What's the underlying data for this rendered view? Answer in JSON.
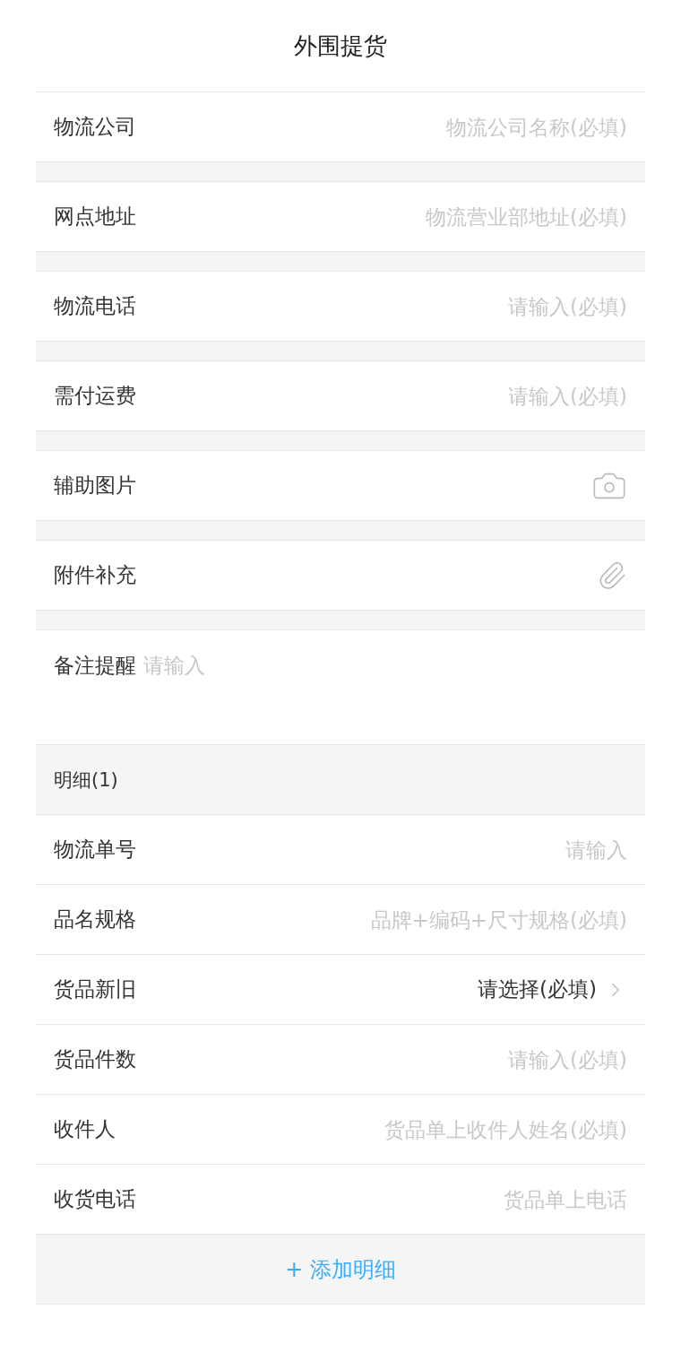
{
  "title": "外围提货",
  "fields": [
    {
      "kind": "input",
      "label": "物流公司",
      "placeholder": "物流公司名称(必填)"
    },
    {
      "kind": "input",
      "label": "网点地址",
      "placeholder": "物流营业部地址(必填)"
    },
    {
      "kind": "input",
      "label": "物流电话",
      "placeholder": "请输入(必填)"
    },
    {
      "kind": "input",
      "label": "需付运费",
      "placeholder": "请输入(必填)"
    },
    {
      "kind": "photo",
      "label": "辅助图片"
    },
    {
      "kind": "attachment",
      "label": "附件补充"
    },
    {
      "kind": "textarea",
      "label": "备注提醒",
      "placeholder": "请输入"
    }
  ],
  "detail": {
    "header": "明细(1)",
    "fields": [
      {
        "kind": "input",
        "label": "物流单号",
        "placeholder": "请输入"
      },
      {
        "kind": "input",
        "label": "品名规格",
        "placeholder": "品牌+编码+尺寸规格(必填)"
      },
      {
        "kind": "select",
        "label": "货品新旧",
        "value": "请选择(必填)"
      },
      {
        "kind": "input",
        "label": "货品件数",
        "placeholder": "请输入(必填)"
      },
      {
        "kind": "input",
        "label": "收件人",
        "placeholder": "货品单上收件人姓名(必填)"
      },
      {
        "kind": "input",
        "label": "收货电话",
        "placeholder": "货品单上电话"
      }
    ]
  },
  "add_button": "+ 添加明细"
}
